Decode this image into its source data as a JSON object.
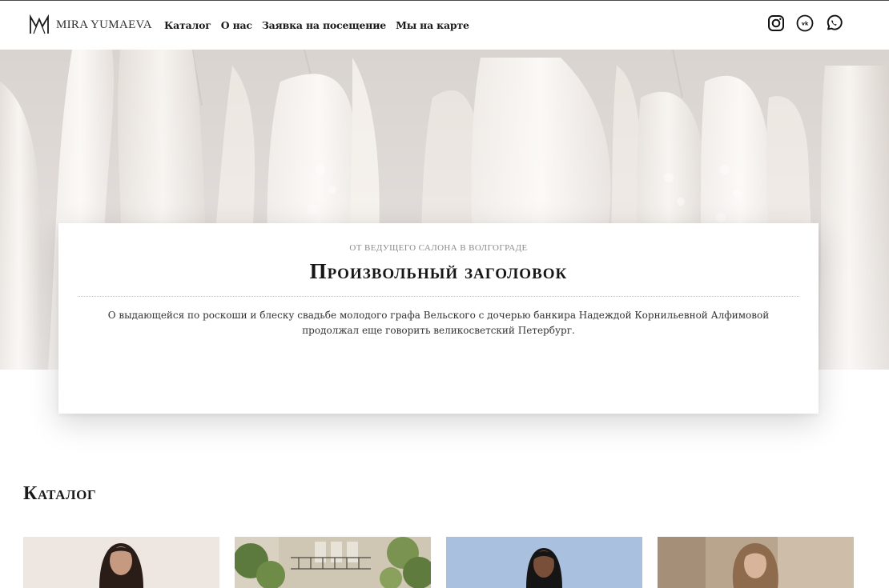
{
  "header": {
    "logo_text": "MIRA YUMAEVA",
    "nav": [
      {
        "label": "Каталог"
      },
      {
        "label": "О нас"
      },
      {
        "label": "Заявка на посещение"
      },
      {
        "label": "Мы на карте"
      }
    ],
    "socials": [
      {
        "icon": "instagram-icon"
      },
      {
        "icon": "vk-icon"
      },
      {
        "icon": "whatsapp-icon"
      }
    ]
  },
  "hero": {
    "kicker": "от ведущего салона в Волгограде",
    "title": "Произвольный заголовок",
    "text": "О выдающейся по роскоши и блеску свадьбе молодого графа Вельского с дочерью банкира Надеждой Корнильевной Алфимовой продолжал еще говорить великосветский Петербург."
  },
  "catalog": {
    "title": "Каталог",
    "items": [
      {
        "image": "model-portrait-1"
      },
      {
        "image": "building-balcony-photo"
      },
      {
        "image": "model-portrait-2"
      },
      {
        "image": "model-portrait-3"
      }
    ]
  },
  "colors": {
    "background": "#ffffff",
    "text": "#1a1a1a",
    "muted": "#8a8a8a",
    "hero_bg": "#dcd6d2"
  }
}
